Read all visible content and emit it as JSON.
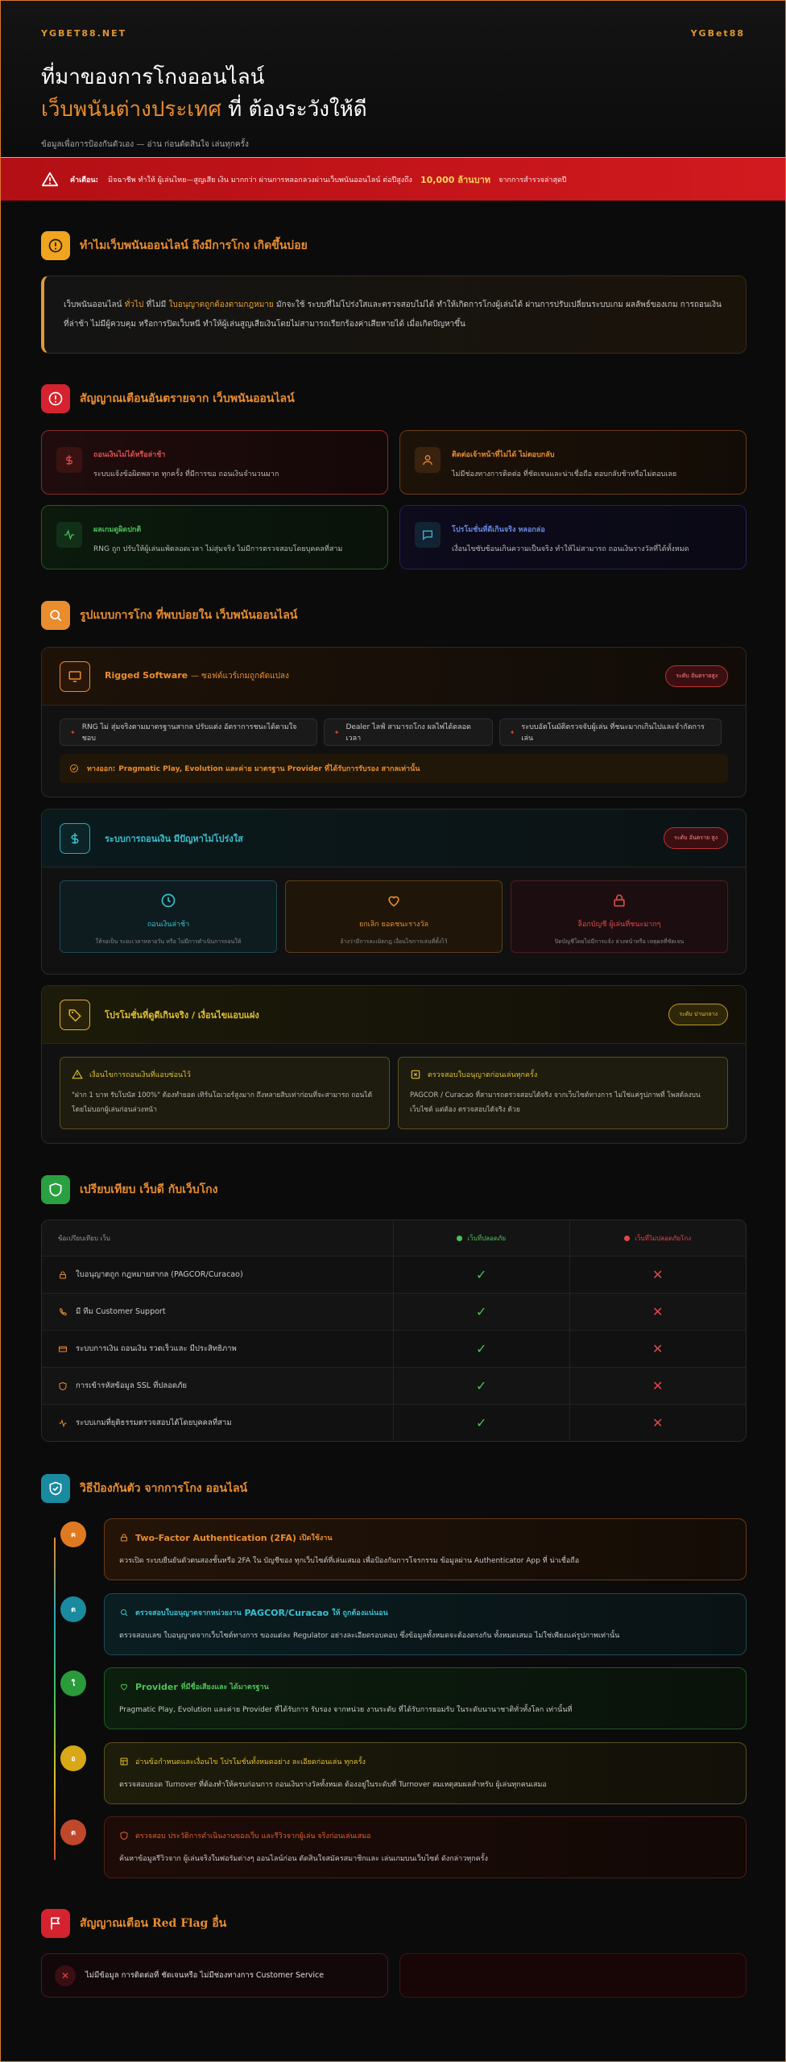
{
  "hero": {
    "brand_left": "YGBET88.NET",
    "brand_right": "YGBet88",
    "title_line1": "ที่มาของการโกงออนไลน์",
    "title_line2_highlight": "เว็บพนันต่างประเทศ",
    "title_line2_rest": "ที่ ต้องระวังให้ดี",
    "subtitle": "ข้อมูลเพื่อการป้องกันตัวเอง — อ่าน ก่อนตัดสินใจ เล่นทุกครั้ง"
  },
  "alert": {
    "label": "คำเตือน:",
    "text": "มิจฉาชีพ ทำให้ ผู้เล่นไทย—สูญเสีย เงิน มากกว่า ผ่านการหลอกลวงผ่านเว็บพนันออนไลน์ ต่อปีสูงถึง",
    "amount": "10,000 ล้านบาท",
    "tail": "จากการสำรวจล่าสุดปี"
  },
  "sections": {
    "s1": "ทำไมเว็บพนันออนไลน์ ถึงมีการโกง เกิดขึ้นบ่อย",
    "s2": "สัญญาณเตือนอันตรายจาก เว็บพนันออนไลน์",
    "s3": "รูปแบบการโกง ที่พบบ่อยใน เว็บพนันออนไลน์",
    "s4": "เปรียบเทียบ เว็บดี กับเว็บโกง",
    "s5": "วิธีป้องกันตัว จากการโกง ออนไลน์",
    "s6": "สัญญาณเตือน",
    "s6_hl": "Red Flag",
    "s6_tail": "อื่น"
  },
  "intro": {
    "p1": "เว็บพนันออนไลน์",
    "y1": "ทั่วไป",
    "p2": "ที่ไม่มี",
    "y2": "ใบอนุญาตถูกต้องตามกฎหมาย",
    "p3": "มักจะใช้ ระบบที่ไม่โปร่งใสและตรวจสอบไม่ได้ ทำให้เกิดการโกงผู้เล่นได้ ผ่านการปรับเปลี่ยนระบบเกม ผลลัพธ์ของเกม การถอนเงินที่ล่าช้า ไม่มีผู้ควบคุม หรือการปิดเว็บหนี ทำให้ผู้เล่นสูญเสียเงินโดยไม่สามารถเรียกร้องค่าเสียหายได้ เมื่อเกิดปัญหาขึ้น"
  },
  "warn_cards": [
    {
      "title": "ถอนเงินไม่ได้หรือล่าช้า",
      "desc": "ระบบแจ้งข้อผิดพลาด ทุกครั้ง ที่มีการขอ ถอนเงินจำนวนมาก"
    },
    {
      "title": "ติดต่อเจ้าหน้าที่ไม่ได้ ไม่ตอบกลับ",
      "desc": "ไม่มีช่องทางการติดต่อ ที่ชัดเจนและน่าเชื่อถือ ตอบกลับช้าหรือไม่ตอบเลย"
    },
    {
      "title": "ผลเกมดูผิดปกติ",
      "desc": "RNG ถูก ปรับให้ผู้เล่นแพ้ตลอดเวลา ไม่สุ่มจริง ไม่มีการตรวจสอบโดยบุคคลที่สาม"
    },
    {
      "title": "โปรโมชั่นที่ดีเกินจริง หลอกล่อ",
      "desc": "เงื่อนไขซับซ้อนเกินความเป็นจริง ทำให้ไม่สามารถ ถอนเงินรางวัลที่ได้ทั้งหมด"
    }
  ],
  "fraud": {
    "p1": {
      "title": "Rigged Software",
      "title_rest": "— ซอฟต์แวร์เกมถูกดัดแปลง",
      "badge": "ระดับ อันตรายสูง",
      "chips": [
        "RNG ไม่ สุ่มจริงตามมาตรฐานสากล ปรับแต่ง อัตราการชนะได้ตามใจ ชอบ",
        "Dealer ไลฟ์ สามารถโกง ผลไพ่ได้ตลอดเวลา",
        "ระบบอัตโนมัติตรวจจับผู้เล่น ที่ชนะมากเกินไปและจำกัดการเล่น"
      ],
      "note_label": "ทางออก:",
      "note": "Pragmatic Play, Evolution และค่าย มาตรฐาน Provider ที่ได้รับการรับรอง สากลเท่านั้น"
    },
    "p2": {
      "title": "ระบบการถอนเงิน มีปัญหาไม่โปร่งใส",
      "badge": "ระดับ อันตราย สูง",
      "boxes": [
        {
          "t": "ถอนเงินล่าช้า",
          "d": "ให้รอเป็น ระยะเวลาหลายวัน หรือ ไม่มีการดำเนินการถอนให้"
        },
        {
          "t": "ยกเลิก ยอดชนะรางวัล",
          "d": "อ้างว่ามีการละเมิดกฎ เงื่อนไขการเล่นที่ตั้งไว้"
        },
        {
          "t": "ล็อกบัญชี ผู้เล่นที่ชนะมากๆ",
          "d": "ปิดบัญชีโดยไม่มีการแจ้ง ล่วงหน้าหรือ เหตุผลที่ชัดเจน"
        }
      ]
    },
    "p3": {
      "title": "โปรโมชั่นที่ดูดีเกินจริง / เงื่อนไขแอบแฝง",
      "badge": "ระดับ ปานกลาง",
      "boxes": [
        {
          "t": "เงื่อนไขการถอนเงินที่แอบซ่อนไว้",
          "d": "\"ฝาก 1 บาท รับโบนัส 100%\" ต้องทำยอด เทิร์นโอเวอร์สูงมาก ถึงหลายสิบเท่าก่อนที่จะสามารถ ถอนได้ โดยไม่บอกผู้เล่นก่อนล่วงหน้า"
        },
        {
          "t": "ตรวจสอบใบอนุญาตก่อนเล่นทุกครั้ง",
          "d": "PAGCOR / Curacao ที่สามารถตรวจสอบได้จริง จากเว็บไซต์ทางการ ไม่ใช่แค่รูปภาพที่ โพสต์ลงบนเว็บไซต์ แต่ต้อง ตรวจสอบได้จริง ด้วย"
        }
      ]
    }
  },
  "compare": {
    "h1": "ข้อเปรียบเทียบ เว็บ",
    "h2": "เว็บที่ปลอดภัย",
    "h3": "เว็บที่ไม่ปลอดภัยโกง",
    "rows": [
      "ใบอนุญาตถูก กฎหมายสากล (PAGCOR/Curacao)",
      "มี ทีม Customer Support",
      "ระบบการเงิน ถอนเงิน รวดเร็วและ มีประสิทธิภาพ",
      "การเข้ารหัสข้อมูล SSL ที่ปลอดภัย",
      "ระบบเกมที่ยุติธรรมตรวจสอบได้โดยบุคคลที่สาม"
    ]
  },
  "steps": [
    {
      "title": "Two-Factor Authentication (2FA)",
      "title_rest": "เปิดใช้งาน",
      "desc": "ควรเปิด ระบบยืนยันตัวตนสองชั้นหรือ 2FA ใน บัญชีของ ทุกเว็บไซต์ที่เล่นเสมอ เพื่อป้องกันการโจรกรรม ข้อมูลผ่าน Authenticator App ที่ น่าเชื่อถือ"
    },
    {
      "title_pre": "ตรวจสอบใบอนุญาตจากหน่วยงาน",
      "title": "PAGCOR/Curacao",
      "title_rest": "ให้ ถูกต้องแน่นอน",
      "desc": "ตรวจสอบเลข ใบอนุญาตจากเว็บไซต์ทางการ ของแต่ละ Regulator อย่างละเอียดรอบคอบ ซึ่งข้อมูลทั้งหมดจะต้องตรงกัน ทั้งหมดเสมอ ไม่ใช่เพียงแค่รูปภาพเท่านั้น"
    },
    {
      "title": "Provider",
      "title_rest": "ที่มีชื่อเสียงและ ได้มาตรฐาน",
      "desc": "Pragmatic Play, Evolution และค่าย Provider ที่ได้รับการ รับรอง จากหน่วย งานระดับ ที่ได้รับการยอมรับ ในระดับนานาชาติทั่วทั้งโลก เท่านั้นที่"
    },
    {
      "title": "อ่านข้อกำหนดและเงื่อนไข โปรโมชั่นทั้งหมดอย่าง ละเอียดก่อนเล่น ทุกครั้ง",
      "desc": "ตรวจสอบยอด Turnover ที่ต้องทำให้ครบก่อนการ ถอนเงินรางวัลทั้งหมด ต้องอยู่ในระดับที่ Turnover สมเหตุสมผลสำหรับ ผู้เล่นทุกคนเสมอ"
    },
    {
      "title": "ตรวจสอบ ประวัติการดำเนินงานของเว็บ และรีวิวจากผู้เล่น จริงก่อนเล่นเสมอ",
      "desc": "ค้นหาข้อมูลรีวิวจาก ผู้เล่นจริงในฟอรัมต่างๆ ออนไลน์ก่อน ตัดสินใจสมัครสมาชิกและ เล่นเกมบนเว็บไซต์ ดังกล่าวทุกครั้ง"
    }
  ],
  "redflag": {
    "item1": "ไม่มีข้อมูล การติดต่อที่ ชัดเจนหรือ ไม่มีช่องทางการ Customer Service"
  },
  "colors": {
    "accent": "#e98d2f",
    "danger": "#d11a1f",
    "safe": "#3bb04a"
  }
}
